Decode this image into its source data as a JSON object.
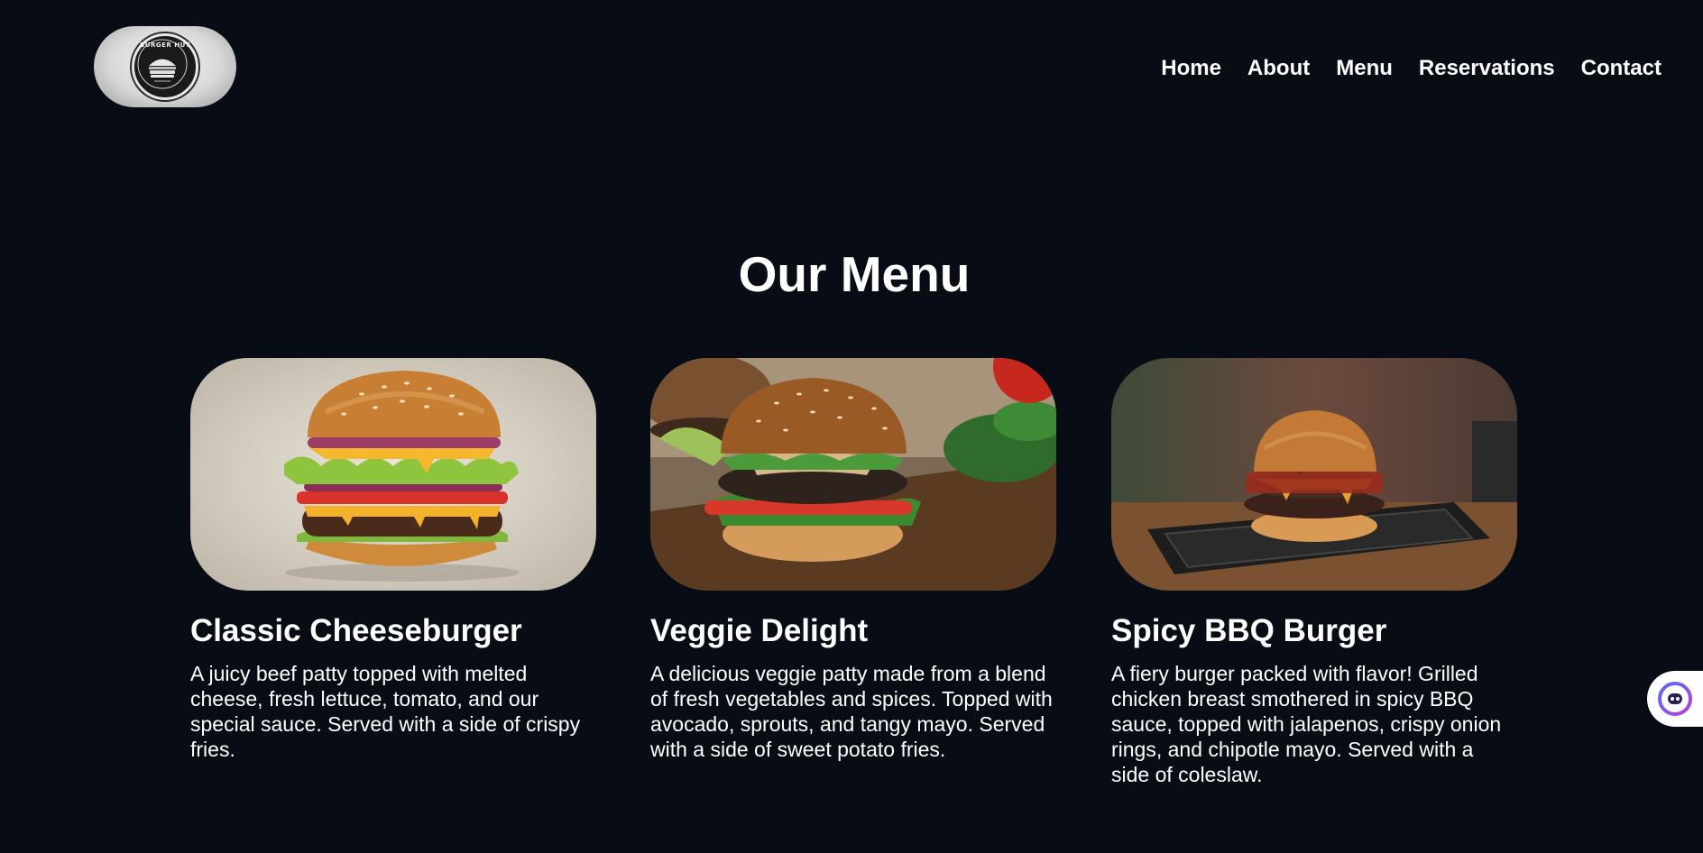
{
  "header": {
    "logo_text": "BURGER HUT",
    "nav": [
      {
        "label": "Home"
      },
      {
        "label": "About"
      },
      {
        "label": "Menu"
      },
      {
        "label": "Reservations"
      },
      {
        "label": "Contact"
      }
    ]
  },
  "menu": {
    "title": "Our Menu",
    "items": [
      {
        "name": "Classic Cheeseburger",
        "description": "A juicy beef patty topped with melted cheese, fresh lettuce, tomato, and our special sauce. Served with a side of crispy fries.",
        "image": "cheeseburger-photo"
      },
      {
        "name": "Veggie Delight",
        "description": "A delicious veggie patty made from a blend of fresh vegetables and spices. Topped with avocado, sprouts, and tangy mayo. Served with a side of sweet potato fries.",
        "image": "veggie-burger-photo"
      },
      {
        "name": "Spicy BBQ Burger",
        "description": "A fiery burger packed with flavor! Grilled chicken breast smothered in spicy BBQ sauce, topped with jalapenos, crispy onion rings, and chipotle mayo. Served with a side of coleslaw.",
        "image": "bbq-burger-photo"
      }
    ]
  },
  "widgets": {
    "chat_icon": "chat-bot-icon"
  },
  "colors": {
    "background": "#080d15",
    "text": "#ffffff",
    "widget_accent": "#7b3fe4"
  }
}
